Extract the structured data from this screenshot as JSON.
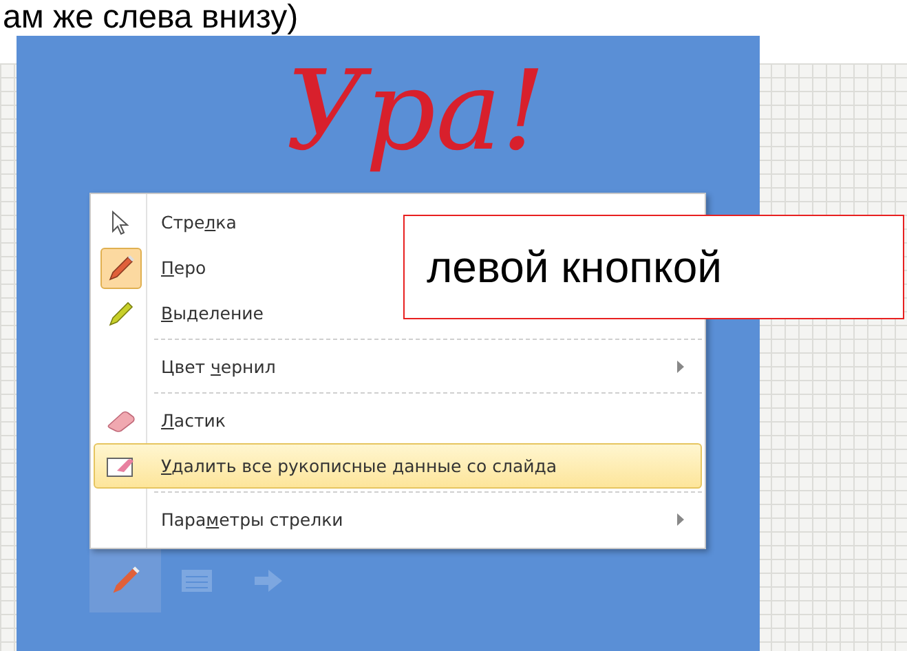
{
  "caption": "ам же слева внизу)",
  "handwriting": "Ура!",
  "menu": [
    {
      "pre": "Стре",
      "key": "л",
      "post": "ка",
      "checked": false,
      "highlighted": false,
      "divider_above": false
    },
    {
      "key": "П",
      "post": "еро",
      "checked": true,
      "highlighted": false,
      "divider_above": false
    },
    {
      "key": "В",
      "post": "ыделение",
      "checked": false,
      "highlighted": false,
      "divider_above": false
    },
    {
      "pre": "Цвет ",
      "key": "ч",
      "post": "ернил",
      "checked": false,
      "highlighted": false,
      "submenu": true,
      "divider_above": true
    },
    {
      "key": "Л",
      "post": "астик",
      "checked": false,
      "highlighted": false,
      "divider_above": true
    },
    {
      "key": "У",
      "post": "далить все рукописные данные со слайда",
      "checked": false,
      "highlighted": true,
      "divider_above": false
    },
    {
      "pre": "Пара",
      "key": "м",
      "post": "етры стрелки",
      "checked": false,
      "highlighted": false,
      "submenu": true,
      "divider_above": true
    }
  ],
  "callout": "левой кнопкой",
  "toolbar": [
    {
      "selected": true
    },
    {
      "selected": false
    },
    {
      "selected": false
    }
  ]
}
